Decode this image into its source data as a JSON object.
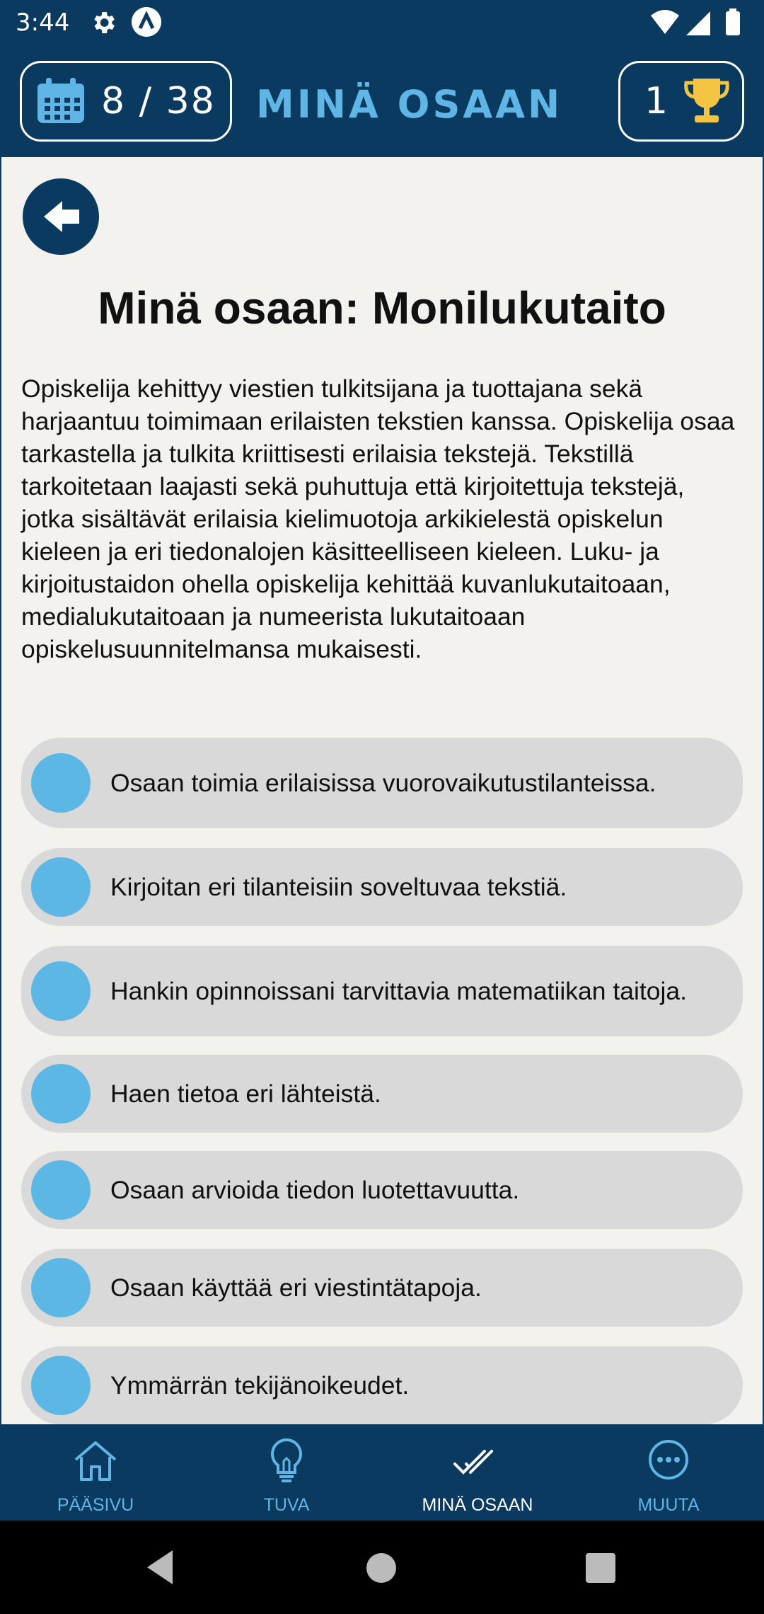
{
  "status_bar": {
    "time": "3:44",
    "icons": [
      "gear-icon",
      "a-icon",
      "wifi-icon",
      "signal-icon",
      "battery-icon"
    ]
  },
  "header": {
    "progress": "8 / 38",
    "progress_current": 8,
    "progress_total": 38,
    "title": "MINÄ OSAAN",
    "trophy_count": "1",
    "icons": [
      "calendar-icon",
      "trophy-icon"
    ]
  },
  "content": {
    "title": "Minä osaan: Monilukutaito",
    "description": "Opiskelija kehittyy viestien tulkitsijana ja tuottajana sekä harjaantuu toimimaan erilaisten tekstien kanssa. Opiskelija osaa tarkastella ja tulkita kriittisesti erilaisia tekstejä. Tekstillä tarkoitetaan laajasti sekä puhuttuja että kirjoitettuja tekstejä, jotka sisältävät erilaisia kielimuotoja arkikielestä opiskelun kieleen ja eri tiedonalojen käsitteelliseen kieleen. Luku- ja kirjoitustaidon ohella opiskelija kehittää kuvanlukutaitoaan, medialukutaitoaan ja numeerista lukutaitoaan opiskelusuunnitelmansa mukaisesti.",
    "items": [
      {
        "label": "Osaan toimia erilaisissa vuorovaikutustilanteissa."
      },
      {
        "label": "Kirjoitan eri tilanteisiin soveltuvaa tekstiä."
      },
      {
        "label": "Hankin opinnoissani tarvittavia matematiikan taitoja."
      },
      {
        "label": "Haen tietoa eri lähteistä."
      },
      {
        "label": "Osaan arvioida tiedon luotettavuutta."
      },
      {
        "label": "Osaan käyttää eri viestintätapoja."
      },
      {
        "label": "Ymmärrän tekijänoikeudet."
      }
    ]
  },
  "bottom_nav": {
    "items": [
      {
        "label": "PÄÄSIVU",
        "icon": "home-icon"
      },
      {
        "label": "TUVA",
        "icon": "lightbulb-icon"
      },
      {
        "label": "MINÄ OSAAN",
        "icon": "double-check-icon",
        "active": true
      },
      {
        "label": "MUUTA",
        "icon": "more-icon"
      }
    ]
  },
  "colors": {
    "primary": "#0a3a5f",
    "accent": "#5fb6e6",
    "dot": "#5cb7e4",
    "item_bg": "#d9d9d9",
    "content_bg": "#f3f2ee",
    "trophy": "#f4c542"
  }
}
